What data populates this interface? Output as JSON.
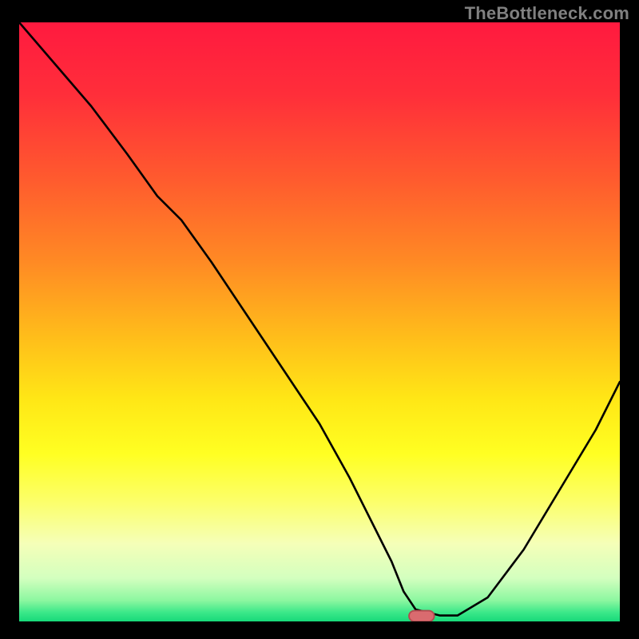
{
  "watermark": "TheBottleneck.com",
  "colors": {
    "bg_black": "#000000",
    "watermark_gray": "#808080",
    "curve_black": "#000000",
    "marker_fill": "#d96b6f",
    "marker_stroke": "#b24b50",
    "gradient_stops": [
      {
        "offset": 0.0,
        "color": "#ff1a3f"
      },
      {
        "offset": 0.12,
        "color": "#ff2e3a"
      },
      {
        "offset": 0.26,
        "color": "#ff5a2e"
      },
      {
        "offset": 0.4,
        "color": "#ff8a24"
      },
      {
        "offset": 0.53,
        "color": "#ffbf1a"
      },
      {
        "offset": 0.63,
        "color": "#ffe716"
      },
      {
        "offset": 0.72,
        "color": "#ffff22"
      },
      {
        "offset": 0.8,
        "color": "#fcff6a"
      },
      {
        "offset": 0.87,
        "color": "#f5ffb8"
      },
      {
        "offset": 0.928,
        "color": "#d3ffbf"
      },
      {
        "offset": 0.965,
        "color": "#8cf7a0"
      },
      {
        "offset": 0.985,
        "color": "#3be889"
      },
      {
        "offset": 1.0,
        "color": "#17d97a"
      }
    ]
  },
  "chart_data": {
    "type": "line",
    "title": "",
    "xlabel": "",
    "ylabel": "",
    "xlim": [
      0,
      100
    ],
    "ylim": [
      0,
      100
    ],
    "grid": false,
    "legend": null,
    "series": [
      {
        "name": "bottleneck-curve",
        "x": [
          0,
          6,
          12,
          18,
          23,
          27,
          32,
          38,
          44,
          50,
          55,
          59,
          62,
          64,
          66,
          70,
          73,
          78,
          84,
          90,
          96,
          100
        ],
        "y": [
          100,
          93,
          86,
          78,
          71,
          67,
          60,
          51,
          42,
          33,
          24,
          16,
          10,
          5,
          2,
          1,
          1,
          4,
          12,
          22,
          32,
          40
        ]
      }
    ],
    "marker": {
      "name": "optimal-point",
      "x": 67,
      "y": 0.9,
      "width": 4.2,
      "height": 1.8
    },
    "note": "x/y are percentages of the plot area; origin at bottom-left"
  }
}
